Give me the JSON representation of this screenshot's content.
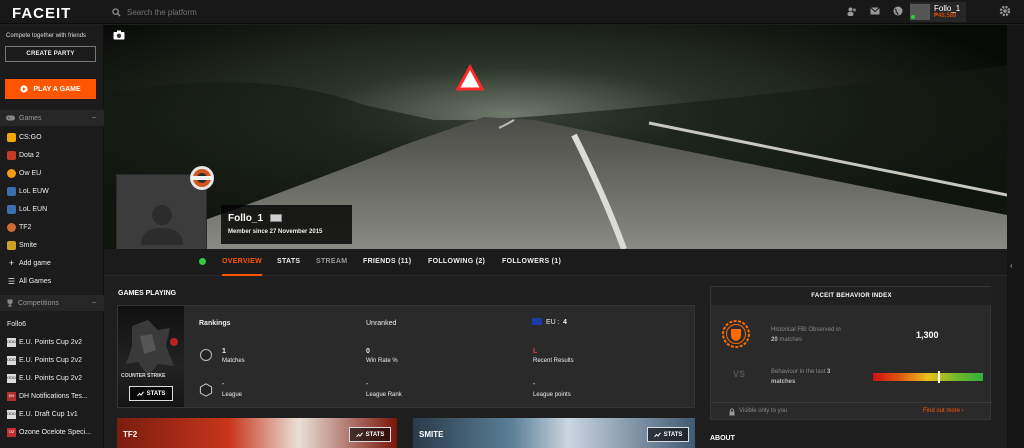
{
  "topbar": {
    "logo": "FACEIT",
    "search_placeholder": "Search the platform",
    "user": {
      "name": "Follo_1",
      "points": "₱48,589"
    }
  },
  "sidebar": {
    "tagline": "Compete together with friends",
    "create_party": "CREATE PARTY",
    "play_game": "PLAY A GAME",
    "games_header": "Games",
    "games": [
      {
        "label": "CS:GO",
        "color": "#f2a900"
      },
      {
        "label": "Dota 2",
        "color": "#c23b22"
      },
      {
        "label": "Ow EU",
        "color": "#f39c12"
      },
      {
        "label": "LoL EUW",
        "color": "#3a6fb0"
      },
      {
        "label": "LoL EUN",
        "color": "#3a6fb0"
      },
      {
        "label": "TF2",
        "color": "#cf6a32"
      },
      {
        "label": "Smite",
        "color": "#c9a227"
      }
    ],
    "add_game": "Add game",
    "all_games": "All Games",
    "competitions_header": "Competitions",
    "competitions_user": "Follo6",
    "competitions": [
      {
        "label": "E.U. Points Cup 2v2",
        "badge": "ODD"
      },
      {
        "label": "E.U. Points Cup 2v2",
        "badge": "ODD"
      },
      {
        "label": "E.U. Points Cup 2v2",
        "badge": "ODD"
      },
      {
        "label": "DH Notifications Tes...",
        "badge": "DH"
      },
      {
        "label": "E.U. Draft Cup 1v1",
        "badge": "ODD"
      },
      {
        "label": "Ozone Ocelote Speci...",
        "badge": "OZ"
      }
    ]
  },
  "profile": {
    "name": "Follo_1",
    "member_since": "Member since 27 November 2015"
  },
  "tabs": [
    {
      "label": "OVERVIEW",
      "active": true
    },
    {
      "label": "STATS"
    },
    {
      "label": "STREAM"
    },
    {
      "label": "FRIENDS (11)"
    },
    {
      "label": "FOLLOWING (2)"
    },
    {
      "label": "FOLLOWERS (1)"
    }
  ],
  "games_playing": {
    "title": "GAMES PLAYING",
    "card": {
      "game_name": "COUNTER STRIKE",
      "stats_label": "STATS",
      "rankings": "Rankings",
      "ranked_status": "Unranked",
      "region": "EU :",
      "region_rank": "4",
      "matches_value": "1",
      "matches_label": "Matches",
      "winrate_value": "0",
      "winrate_label": "Win Rate %",
      "recent_value": "L",
      "recent_label": "Recent Results",
      "league_value": "-",
      "league_label": "League",
      "league_rank_value": "-",
      "league_rank_label": "League Rank",
      "league_points_value": "-",
      "league_points_label": "League points"
    },
    "bottom_cards": [
      {
        "title": "TF2",
        "stats_label": "STATS"
      },
      {
        "title": "SMITE",
        "stats_label": "STATS"
      }
    ]
  },
  "fbi": {
    "title": "FACEIT BEHAVIOR INDEX",
    "observed_text": "Historical FBI Observed in",
    "observed_bold": "20",
    "observed_suffix": "matches",
    "score": "1,300",
    "behaviour_text": "Behaviour in the last",
    "behaviour_bold": "3",
    "behaviour_suffix": "matches",
    "gauge_level": 0.6,
    "visibility": "Visible only to you",
    "find_out_more": "Find out more ›"
  },
  "about_title": "ABOUT"
}
